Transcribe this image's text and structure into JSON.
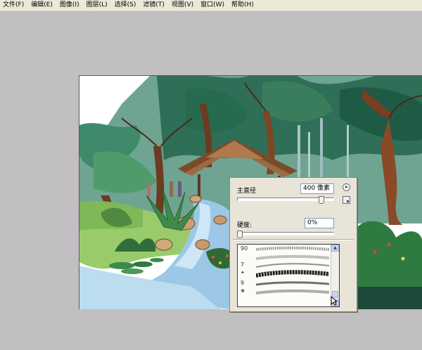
{
  "menubar": {
    "items": [
      "文件(F)",
      "编辑(E)",
      "图像(I)",
      "图层(L)",
      "选择(S)",
      "滤镜(T)",
      "视图(V)",
      "窗口(W)",
      "帮助(H)"
    ]
  },
  "brush_panel": {
    "diameter_label": "主直径",
    "diameter_value": "400 像素",
    "hardness_label": "硬度:",
    "hardness_value": "0%",
    "brush_sizes": [
      "90",
      "7",
      "9"
    ]
  },
  "colors": {
    "workspace": "#c1bfc1",
    "panel": "#e8e4d8",
    "accent": "#2a4a8a"
  },
  "icons": [
    "flyout-arrow-icon",
    "new-preset-icon",
    "scroll-up-icon",
    "scroll-down-icon",
    "mouse-cursor-icon"
  ]
}
